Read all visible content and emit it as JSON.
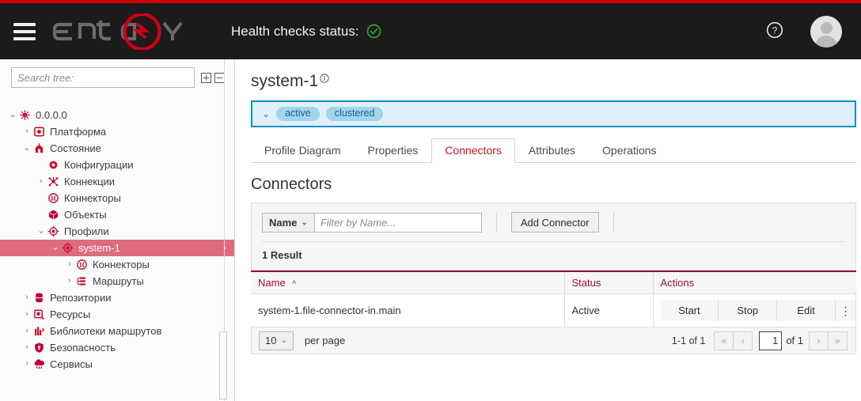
{
  "colors": {
    "brand_red": "#cc0000",
    "accent_crimson": "#a00e28",
    "tab_active": "#c8102e",
    "tree_selected": "#df6b7e",
    "info_panel_bg": "#dff0fa",
    "info_panel_border": "#0d8ec4",
    "chip_bg": "#a3d4ec",
    "health_ok_green": "#2aa32a",
    "topbar_bg": "#1b1b1b"
  },
  "topbar": {
    "menu_icon": "hamburger-icon",
    "logo_text": "ENTAXY",
    "health_label": "Health checks status:",
    "health_icon": "check-circle-icon",
    "help_icon": "question-circle-icon",
    "avatar_icon": "user-avatar-icon"
  },
  "sidebar": {
    "search_placeholder": "Search tree:",
    "search_value": "",
    "expand_all_icon": "expand-all-icon",
    "collapse_all_icon": "collapse-all-icon",
    "tree": [
      {
        "label": "0.0.0.0",
        "indent": 0,
        "caret": "down",
        "icon": "node-root-icon",
        "selected": false
      },
      {
        "label": "Платформа",
        "indent": 1,
        "caret": "right",
        "icon": "platform-icon",
        "selected": false
      },
      {
        "label": "Состояние",
        "indent": 1,
        "caret": "down",
        "icon": "state-icon",
        "selected": false
      },
      {
        "label": "Конфигурации",
        "indent": 2,
        "caret": "none",
        "icon": "configuration-icon",
        "selected": false
      },
      {
        "label": "Коннекции",
        "indent": 2,
        "caret": "right",
        "icon": "connections-icon",
        "selected": false
      },
      {
        "label": "Коннекторы",
        "indent": 2,
        "caret": "none",
        "icon": "connectors-icon",
        "selected": false
      },
      {
        "label": "Объекты",
        "indent": 2,
        "caret": "none",
        "icon": "objects-icon",
        "selected": false
      },
      {
        "label": "Профили",
        "indent": 2,
        "caret": "down",
        "icon": "profiles-icon",
        "selected": false
      },
      {
        "label": "system-1",
        "indent": 3,
        "caret": "down",
        "icon": "profile-icon",
        "selected": true
      },
      {
        "label": "Коннекторы",
        "indent": 4,
        "caret": "right",
        "icon": "connectors-icon",
        "selected": false
      },
      {
        "label": "Маршруты",
        "indent": 4,
        "caret": "right",
        "icon": "routes-icon",
        "selected": false
      },
      {
        "label": "Репозитории",
        "indent": 1,
        "caret": "right",
        "icon": "repositories-icon",
        "selected": false
      },
      {
        "label": "Ресурсы",
        "indent": 1,
        "caret": "right",
        "icon": "resources-icon",
        "selected": false
      },
      {
        "label": "Библиотеки маршрутов",
        "indent": 1,
        "caret": "right",
        "icon": "route-libraries-icon",
        "selected": false
      },
      {
        "label": "Безопасность",
        "indent": 1,
        "caret": "right",
        "icon": "security-icon",
        "selected": false
      },
      {
        "label": "Сервисы",
        "indent": 1,
        "caret": "right",
        "icon": "services-icon",
        "selected": false
      }
    ]
  },
  "main": {
    "page_title": "system-1",
    "info_icon": "info-circle-icon",
    "status_caret_icon": "chevron-down-icon",
    "status_chips": [
      "active",
      "clustered"
    ],
    "tabs": [
      {
        "label": "Profile Diagram",
        "active": false
      },
      {
        "label": "Properties",
        "active": false
      },
      {
        "label": "Connectors",
        "active": true
      },
      {
        "label": "Attributes",
        "active": false
      },
      {
        "label": "Operations",
        "active": false
      }
    ],
    "section_title": "Connectors",
    "filter": {
      "field_label": "Name",
      "field_caret_icon": "chevron-down-icon",
      "placeholder": "Filter by Name...",
      "value": ""
    },
    "add_button": "Add Connector",
    "result_text": "1 Result",
    "table": {
      "columns": [
        "Name",
        "Status",
        "Actions"
      ],
      "sort_column": "Name",
      "sort_icon": "sort-asc-icon",
      "rows": [
        {
          "name": "system-1.file-connector-in.main",
          "status": "Active",
          "actions": [
            "Start",
            "Stop",
            "Edit"
          ],
          "more_icon": "kebab-menu-icon"
        }
      ]
    },
    "footer": {
      "per_page_value": "10",
      "per_page_caret_icon": "chevron-down-icon",
      "per_page_label": "per page",
      "range_text": "1-1 of 1",
      "first_icon": "«",
      "prev_icon": "‹",
      "page_value": "1",
      "of_text": "of 1",
      "next_icon": "›",
      "last_icon": "»"
    }
  }
}
